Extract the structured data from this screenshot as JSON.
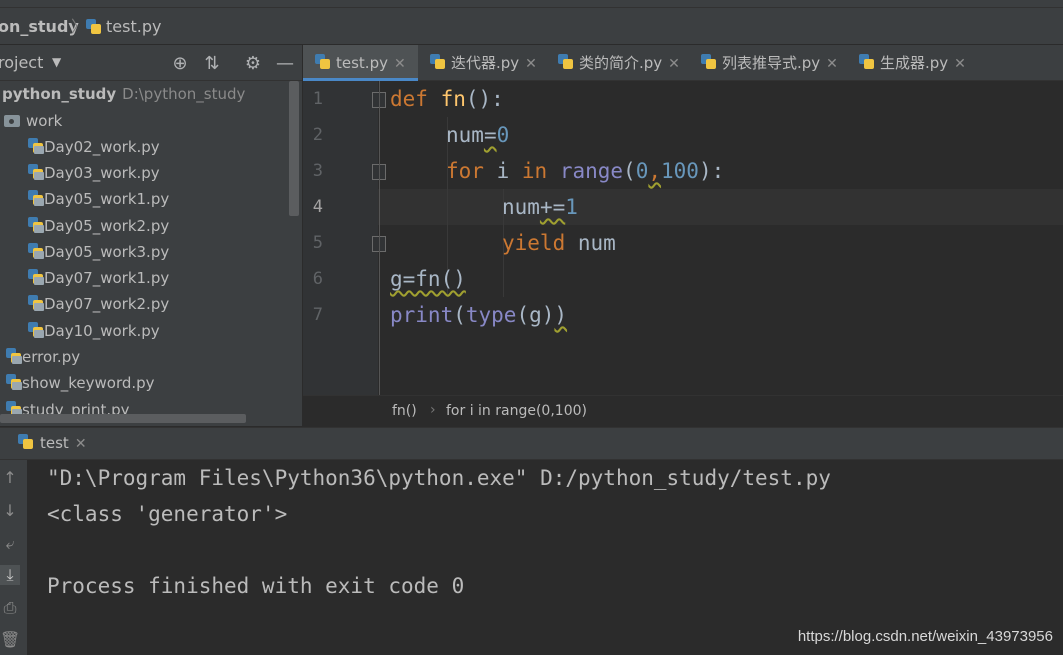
{
  "breadcrumb": {
    "project": "on_study",
    "file": "test.py"
  },
  "project_panel": {
    "title": "roject",
    "tree": [
      {
        "label": "python_study",
        "path": "D:\\python_study",
        "kind": "root"
      },
      {
        "label": "work",
        "kind": "folder"
      },
      {
        "label": "Day02_work.py",
        "kind": "file"
      },
      {
        "label": "Day03_work.py",
        "kind": "file"
      },
      {
        "label": "Day05_work1.py",
        "kind": "file"
      },
      {
        "label": "Day05_work2.py",
        "kind": "file"
      },
      {
        "label": "Day05_work3.py",
        "kind": "file"
      },
      {
        "label": "Day07_work1.py",
        "kind": "file"
      },
      {
        "label": "Day07_work2.py",
        "kind": "file"
      },
      {
        "label": "Day10_work.py",
        "kind": "file"
      },
      {
        "label": "error.py",
        "kind": "file"
      },
      {
        "label": "show_keyword.py",
        "kind": "file"
      },
      {
        "label": "study_print.py",
        "kind": "file"
      }
    ]
  },
  "tabs": [
    {
      "label": "test.py",
      "active": true
    },
    {
      "label": "迭代器.py",
      "active": false
    },
    {
      "label": "类的简介.py",
      "active": false
    },
    {
      "label": "列表推导式.py",
      "active": false
    },
    {
      "label": "生成器.py",
      "active": false
    }
  ],
  "editor": {
    "line_numbers": [
      "1",
      "2",
      "3",
      "4",
      "5",
      "6",
      "7"
    ],
    "current_line": 4,
    "code": [
      [
        "def",
        " ",
        "fn",
        "():"
      ],
      [
        "num",
        "=",
        "0"
      ],
      [
        "for",
        " i ",
        "in",
        " ",
        "range",
        "(",
        "0",
        ",",
        "100",
        "):"
      ],
      [
        "num",
        "+=",
        "1"
      ],
      [
        "yield",
        " num"
      ],
      [
        "g=fn()"
      ],
      [
        "print",
        "(",
        "type",
        "(g)",
        ")"
      ]
    ],
    "crumbs": [
      "fn()",
      "for i in range(0,100)"
    ]
  },
  "run": {
    "tab_label": "test",
    "output": [
      "\"D:\\Program Files\\Python36\\python.exe\" D:/python_study/test.py",
      "<class 'generator'>",
      "",
      "Process finished with exit code 0"
    ]
  },
  "watermark": "https://blog.csdn.net/weixin_43973956",
  "colors": {
    "keyword": "#cc7832",
    "function": "#ffc66d",
    "number": "#6897bb",
    "builtin": "#8888c6",
    "background": "#2b2b2b",
    "panel": "#3c3f41"
  }
}
